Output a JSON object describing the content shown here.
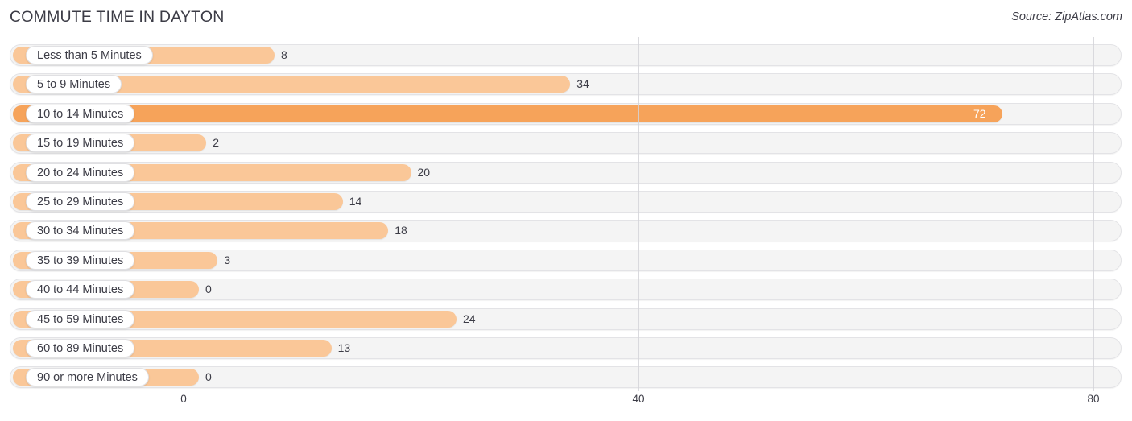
{
  "header": {
    "title": "COMMUTE TIME IN DAYTON",
    "source": "Source: ZipAtlas.com"
  },
  "colors": {
    "bar": "#fac798",
    "bar_highlight": "#f6a35a",
    "track": "#f4f4f4",
    "text": "#3c3c46",
    "gridline": "#d4d4d8"
  },
  "chart_data": {
    "type": "bar",
    "orientation": "horizontal",
    "title": "COMMUTE TIME IN DAYTON",
    "xlabel": "",
    "ylabel": "",
    "xlim": [
      0,
      80
    ],
    "ticks": [
      0,
      40,
      80
    ],
    "tick_labels": [
      "0",
      "40",
      "80"
    ],
    "grid": true,
    "legend": false,
    "categories": [
      "Less than 5 Minutes",
      "5 to 9 Minutes",
      "10 to 14 Minutes",
      "15 to 19 Minutes",
      "20 to 24 Minutes",
      "25 to 29 Minutes",
      "30 to 34 Minutes",
      "35 to 39 Minutes",
      "40 to 44 Minutes",
      "45 to 59 Minutes",
      "60 to 89 Minutes",
      "90 or more Minutes"
    ],
    "values": [
      8,
      34,
      72,
      2,
      20,
      14,
      18,
      3,
      0,
      24,
      13,
      0
    ],
    "value_labels": [
      "8",
      "34",
      "72",
      "2",
      "20",
      "14",
      "18",
      "3",
      "0",
      "24",
      "13",
      "0"
    ],
    "highlight_index": 2,
    "max_value": 72
  }
}
